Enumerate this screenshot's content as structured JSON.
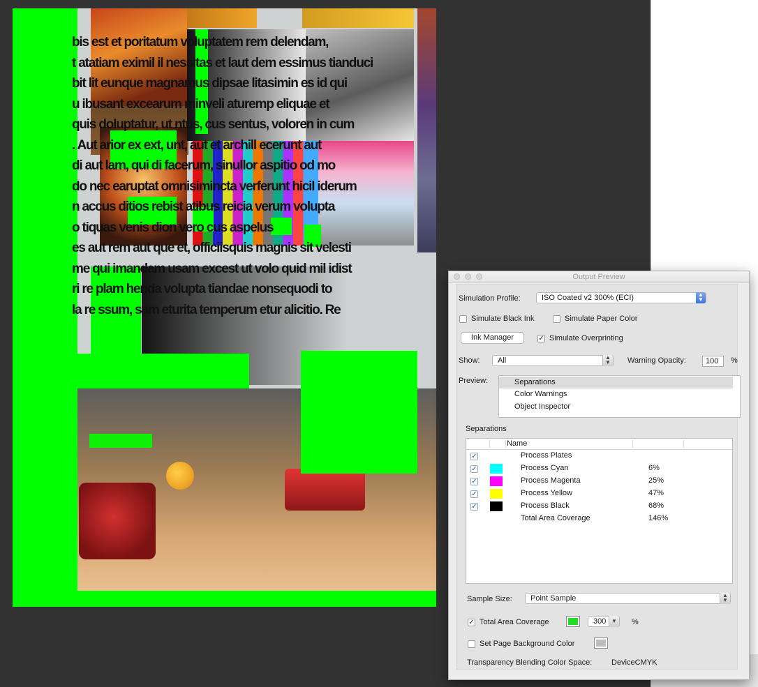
{
  "document": {
    "body_text_lines": [
      "bis est et poritatum voluptatem rem delendam,",
      "t atatiam eximil il nessitas et laut dem essimus tianduci",
      "bit lit eunque magnamus dipsae litasimin es id qui",
      "u ibusant excearum minveli aturemp eliquae et",
      "quis doluptatur, ut ntus, cus sentus, voloren in cum",
      ". Aut arior ex ext, unt, aut et archill ecerunt aut",
      "di aut lam, qui di facerum, sinullor aspitio od mo",
      "do nec earuptat omnisimincta verferunt hicil iderum",
      "n accus ditios rebist atibus reicia verum volupta",
      "o tiquas venis dion vero cus aspelus",
      "es aut rem aut que et, officiisquis magnis sit velesti",
      "me qui imandam usam excest ut volo quid mil idist",
      "ri re plam henda volupta tiandae nonsequodi to",
      "la re ssum, sam eturita temperum etur alicitio. Re"
    ],
    "warning_color": "#00ff00"
  },
  "panel": {
    "title": "Output Preview",
    "simulation_profile_label": "Simulation Profile:",
    "simulation_profile_value": "ISO Coated v2 300% (ECI)",
    "simulate_black_ink": {
      "label": "Simulate Black Ink",
      "checked": false
    },
    "simulate_paper_color": {
      "label": "Simulate Paper Color",
      "checked": false
    },
    "ink_manager_label": "Ink Manager",
    "simulate_overprinting": {
      "label": "Simulate Overprinting",
      "checked": true
    },
    "show_label": "Show:",
    "show_value": "All",
    "warning_opacity_label": "Warning Opacity:",
    "warning_opacity_value": "100",
    "warning_opacity_unit": "%",
    "preview_label": "Preview:",
    "preview_items": [
      "Separations",
      "Color Warnings",
      "Object Inspector"
    ],
    "preview_selected": "Separations",
    "separations_label": "Separations",
    "separations_column_name": "Name",
    "separations": [
      {
        "name": "Process Plates",
        "percent": "",
        "checked": true,
        "swatch": ""
      },
      {
        "name": "Process Cyan",
        "percent": "6%",
        "checked": true,
        "swatch": "#00ffff"
      },
      {
        "name": "Process Magenta",
        "percent": "25%",
        "checked": true,
        "swatch": "#ff00ff"
      },
      {
        "name": "Process Yellow",
        "percent": "47%",
        "checked": true,
        "swatch": "#ffff00"
      },
      {
        "name": "Process Black",
        "percent": "68%",
        "checked": true,
        "swatch": "#000000"
      },
      {
        "name": "Total Area Coverage",
        "percent": "146%",
        "checked": false,
        "swatch": ""
      }
    ],
    "sample_size_label": "Sample Size:",
    "sample_size_value": "Point Sample",
    "total_area_coverage": {
      "label": "Total Area Coverage",
      "checked": true,
      "color": "#22dd22",
      "value": "300",
      "unit": "%"
    },
    "set_page_background": {
      "label": "Set Page Background Color",
      "checked": false,
      "color": "#bdbdbd"
    },
    "transparency_label": "Transparency Blending Color Space:",
    "transparency_value": "DeviceCMYK"
  }
}
